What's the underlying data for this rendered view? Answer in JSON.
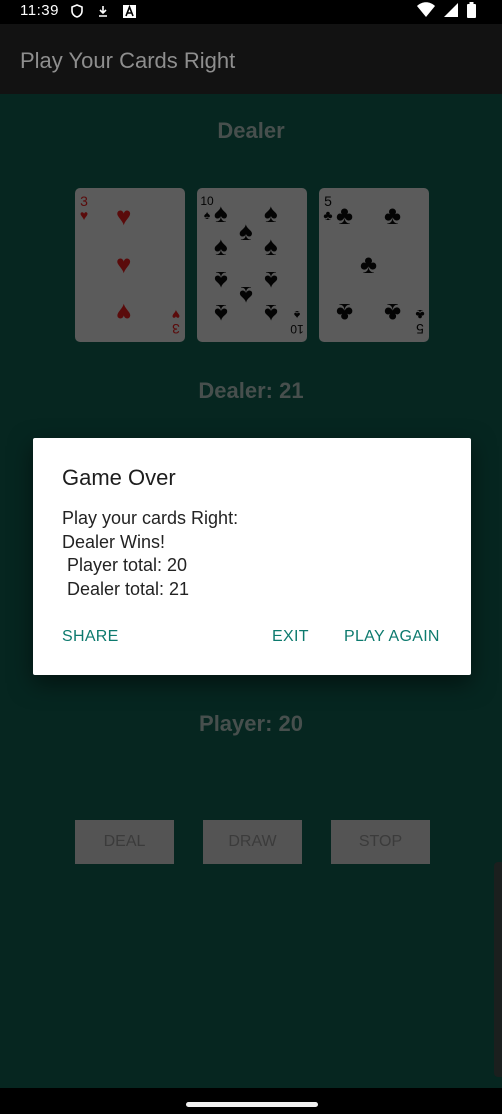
{
  "status_bar": {
    "time": "11:39",
    "icons": [
      "shield-icon",
      "download-icon",
      "a-icon",
      "wifi-icon",
      "signal-icon",
      "battery-icon"
    ]
  },
  "app_bar": {
    "title": "Play Your Cards Right"
  },
  "dealer": {
    "heading": "Dealer",
    "total_label": "Dealer: 21",
    "cards": [
      {
        "rank": "3",
        "suit": "hearts"
      },
      {
        "rank": "10",
        "suit": "spades"
      },
      {
        "rank": "5",
        "suit": "clubs"
      }
    ]
  },
  "player": {
    "total_label": "Player: 20"
  },
  "actions": {
    "deal": "DEAL",
    "draw": "DRAW",
    "stop": "STOP"
  },
  "dialog": {
    "title": "Game Over",
    "message": "Play your cards Right:\nDealer Wins!\n Player total: 20\n Dealer total: 21",
    "share": "SHARE",
    "exit": "EXIT",
    "play_again": "PLAY AGAIN"
  },
  "colors": {
    "background": "#062620",
    "accent": "#0d7a6e",
    "hearts": "#5a0b0b"
  }
}
